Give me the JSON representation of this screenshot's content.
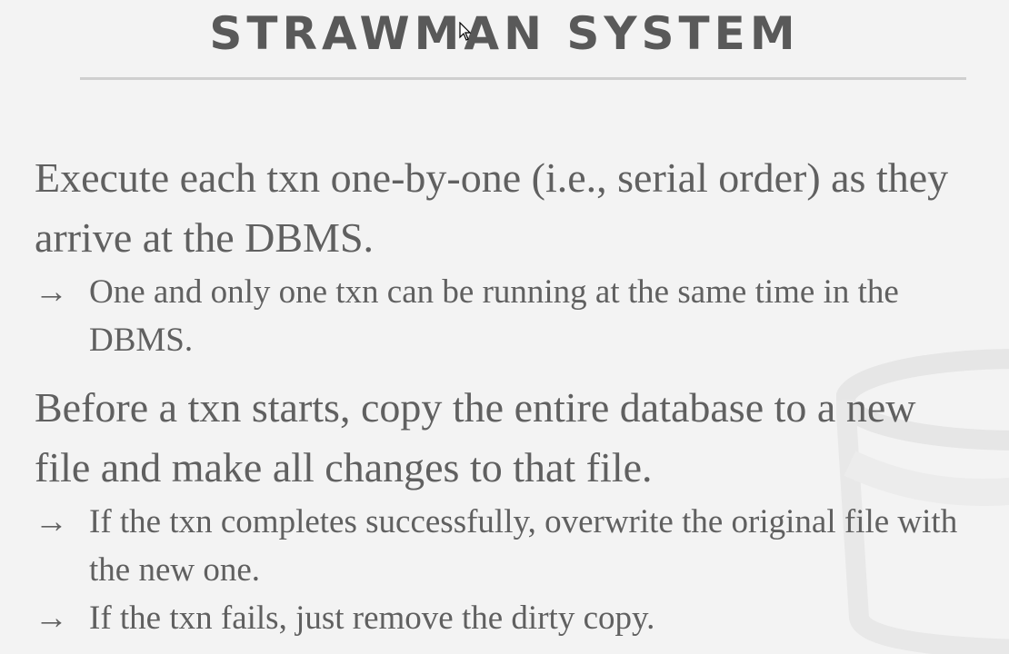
{
  "title": "STRAWMAN SYSTEM",
  "bullets": [
    {
      "text": "Execute each txn one-by-one (i.e., serial order) as they arrive at the DBMS.",
      "subs": [
        "One and only one txn can be running at the same time in the DBMS."
      ]
    },
    {
      "text": "Before a txn starts, copy the entire database to a new file and make all changes to that file.",
      "subs": [
        "If the txn completes successfully, overwrite the original file with the new one.",
        "If the txn fails, just remove the dirty copy."
      ]
    }
  ],
  "arrow": "→"
}
